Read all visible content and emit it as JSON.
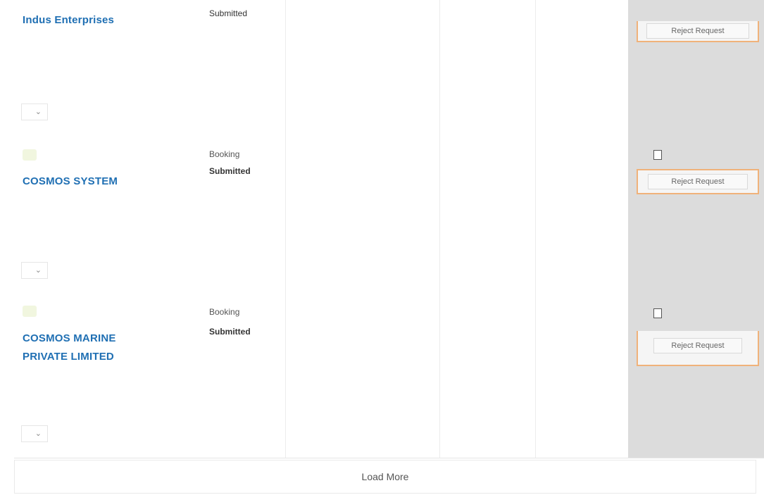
{
  "rows": [
    {
      "company": "Indus Enterprises",
      "status_label": "",
      "status_sub": "Submitted",
      "selector": "",
      "col3": "",
      "col4": "",
      "col5": "",
      "col6": "",
      "panel_button": "Reject Request"
    },
    {
      "chip": "",
      "company": "COSMOS SYSTEM",
      "status_label": "Booking",
      "status_sub": "Submitted",
      "selector": "",
      "col3": "",
      "col4": "",
      "col5": "",
      "col6": "",
      "panel_check_label": "",
      "panel_button": "Reject Request"
    },
    {
      "chip": "",
      "company": "COSMOS MARINE PRIVATE LIMITED",
      "status_label": "Booking",
      "status_sub": "Submitted",
      "selector": "",
      "col3": "",
      "col4": "",
      "col5": "",
      "col6": "",
      "panel_check_label": "",
      "panel_button": "Reject Request"
    }
  ],
  "load_more": "Load More"
}
